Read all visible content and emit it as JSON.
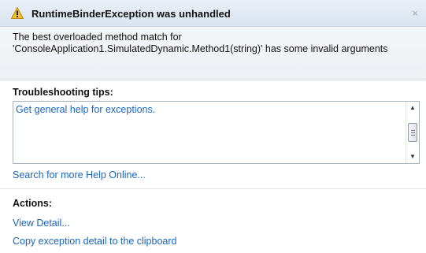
{
  "dialog": {
    "title": "RuntimeBinderException was unhandled",
    "close_glyph": "×",
    "message": "The best overloaded method match for 'ConsoleApplication1.SimulatedDynamic.Method1(string)' has some invalid arguments"
  },
  "troubleshooting": {
    "label": "Troubleshooting tips:",
    "tips": [
      "Get general help for exceptions."
    ],
    "search_link": "Search for more Help Online..."
  },
  "actions": {
    "label": "Actions:",
    "items": [
      "View Detail...",
      "Copy exception detail to the clipboard"
    ]
  },
  "icons": {
    "warning": "warning-icon",
    "close": "close-icon",
    "scroll_up": "scroll-up-icon",
    "scroll_down": "scroll-down-icon"
  },
  "colors": {
    "link": "#1a66c2",
    "warning": "#f2c12e"
  }
}
